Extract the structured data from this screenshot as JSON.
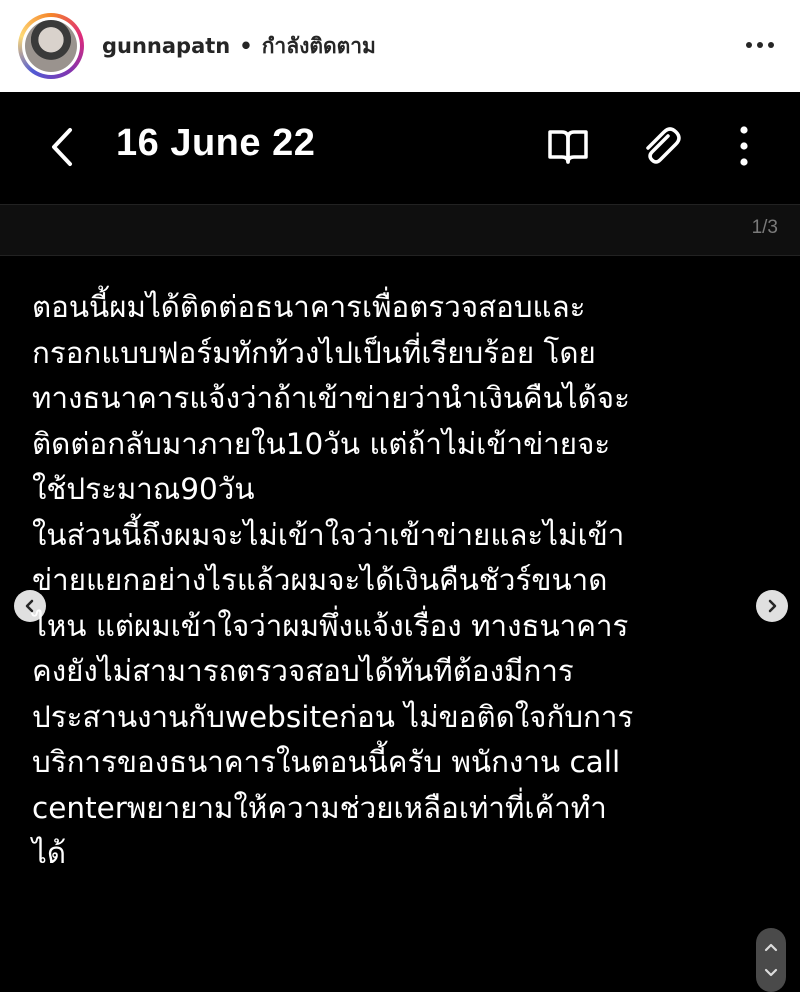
{
  "header": {
    "username": "gunnapatn",
    "separator": "•",
    "follow_status": "กำลังติดตาม",
    "more_icon": "more-horizontal-icon"
  },
  "note": {
    "title": "16 June 22",
    "page_indicator": "1/3",
    "back_icon": "chevron-left-icon",
    "book_icon": "book-open-icon",
    "attach_icon": "paperclip-icon",
    "menu_icon": "more-vertical-icon",
    "lines": [
      "ตอนนี้ผมได้ติดต่อธนาคารเพื่อตรวจสอบและ",
      "กรอกแบบฟอร์มทักท้วงไปเป็นที่เรียบร้อย โดย",
      "ทางธนาคารแจ้งว่าถ้าเข้าข่ายว่านำเงินคืนได้จะ",
      "ติดต่อกลับมาภายใน10วัน แต่ถ้าไม่เข้าข่ายจะ",
      "ใช้ประมาณ90วัน",
      "ในส่วนนี้ถึงผมจะไม่เข้าใจว่าเข้าข่ายและไม่เข้า",
      "ข่ายแยกอย่างไรแล้วผมจะได้เงินคืนชัวร์ขนาด",
      "ไหน แต่ผมเข้าใจว่าผมพึ่งแจ้งเรื่อง ทางธนาคาร",
      "คงยังไม่สามารถตรวจสอบได้ทันทีต้องมีการ",
      "ประสานงานกับwebsiteก่อน ไม่ขอติดใจกับการ",
      "บริการของธนาคารในตอนนี้ครับ พนักงาน call",
      "centerพยายามให้ความช่วยเหลือเท่าที่เค้าทำ",
      "ได้"
    ]
  },
  "colors": {
    "background": "#000000",
    "text": "#ffffff",
    "header_bg": "#ffffff",
    "muted": "#7a7a7a"
  }
}
